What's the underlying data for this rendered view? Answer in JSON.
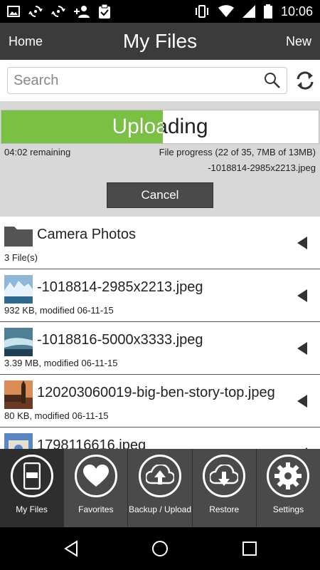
{
  "status_bar": {
    "time": "10:06",
    "left_icons": [
      "image-icon",
      "sync-icon",
      "sync-icon",
      "add-person-icon",
      "clipboard-check-icon"
    ],
    "right_icons": [
      "vibrate-icon",
      "wifi-icon",
      "signal-icon",
      "battery-icon"
    ]
  },
  "header": {
    "home_label": "Home",
    "title": "My Files",
    "new_label": "New"
  },
  "search": {
    "placeholder": "Search",
    "value": ""
  },
  "upload": {
    "label": "Uploading",
    "progress_fraction": 0.51,
    "remaining": "04:02 remaining",
    "status": "File progress (22 of 35, 7MB of 13MB)",
    "filename": "-1018814-2985x2213.jpeg",
    "cancel_label": "Cancel",
    "accent_color": "#7ac143"
  },
  "files": [
    {
      "name": "Camera Photos",
      "meta": "3 File(s)",
      "type": "folder",
      "icon": "folder-icon"
    },
    {
      "name": "-1018814-2985x2213.jpeg",
      "meta": "932 KB, modified 06-11-15",
      "type": "image",
      "icon": "glacier-thumbnail"
    },
    {
      "name": "-1018816-5000x3333.jpeg",
      "meta": "3.39 MB, modified 06-11-15",
      "type": "image",
      "icon": "ice-thumbnail"
    },
    {
      "name": "120203060019-big-ben-story-top.jpeg",
      "meta": "80 KB, modified 06-11-15",
      "type": "image",
      "icon": "big-ben-thumbnail"
    },
    {
      "name": "1798116616.jpeg",
      "meta": "",
      "type": "image",
      "icon": "arch-thumbnail"
    }
  ],
  "tabs": [
    {
      "label": "My Files",
      "icon": "phone-icon",
      "active": true
    },
    {
      "label": "Favorites",
      "icon": "heart-icon",
      "active": false
    },
    {
      "label": "Backup / Upload",
      "icon": "cloud-upload-icon",
      "active": false
    },
    {
      "label": "Restore",
      "icon": "cloud-download-icon",
      "active": false
    },
    {
      "label": "Settings",
      "icon": "gear-icon",
      "active": false
    }
  ],
  "nav": [
    "back-icon",
    "home-icon",
    "recents-icon"
  ]
}
